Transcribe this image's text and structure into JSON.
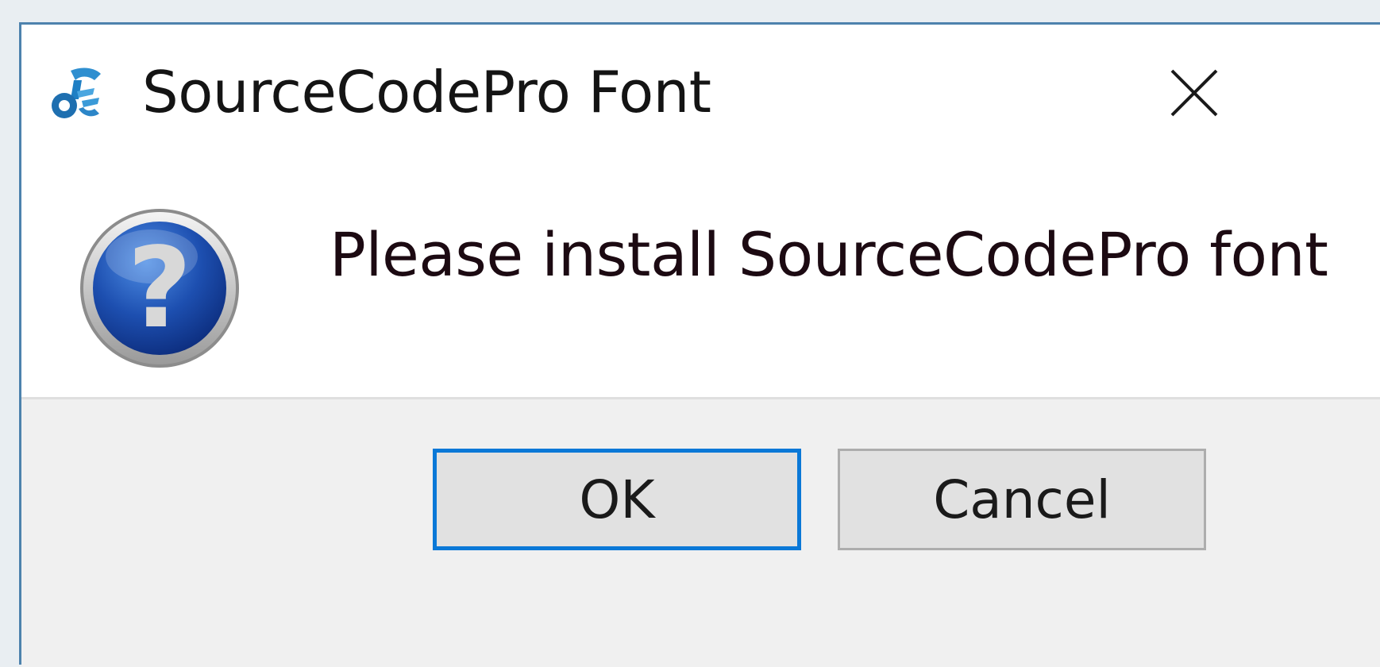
{
  "dialog": {
    "title": "SourceCodePro Font",
    "app_icon": "app-logo-icon",
    "close_icon": "close-icon",
    "status_icon": "question-icon",
    "message": "Please install SourceCodePro font",
    "buttons": {
      "ok_label": "OK",
      "cancel_label": "Cancel"
    },
    "colors": {
      "focus_border": "#0a78d7",
      "window_border": "#4d82ad",
      "footer_bg": "#f0f0f0",
      "button_bg": "#e1e1e1"
    }
  }
}
